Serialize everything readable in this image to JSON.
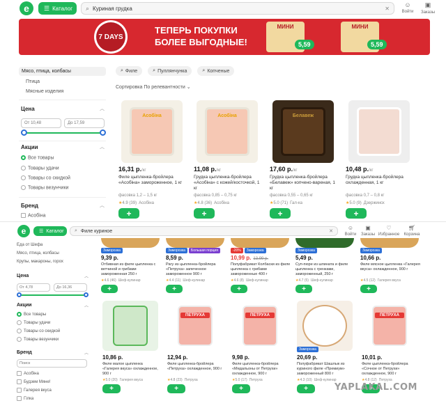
{
  "top": {
    "logo": "e",
    "catalog_label": "Каталог",
    "search_value": "Куриная грудка",
    "login_label": "Войти",
    "orders_label": "Заказы"
  },
  "banner": {
    "brand": "7 DAYS",
    "headline_1": "ТЕПЕРЬ ПОКУПКИ",
    "headline_2": "БОЛЕЕ ВЫГОДНЫЕ!",
    "product_name": "МИНИ",
    "price_1": "5,59",
    "price_2": "5,59",
    "bg": "#d7282f"
  },
  "sidebar": {
    "categories": [
      "Мясо, птица, колбасы",
      "Птица",
      "Мясные изделия"
    ],
    "price_title": "Цена",
    "price_from": "От 10,48",
    "price_to": "До 17,59",
    "promo_title": "Акции",
    "promo_options": [
      "Все товары",
      "Товары удачи",
      "Товары со скидкой",
      "Товары везунчики"
    ],
    "brand_title": "Бренд",
    "brand_first": "Асобіна"
  },
  "chips": [
    "Филе",
    "Пуллянчунка",
    "Копченые"
  ],
  "sort_label": "Сортировка По релевантности",
  "products": [
    {
      "price": "16,31 р.",
      "unit": "/кг",
      "name": "Филе цыпленка-бройлера «Асобіна» замороженное, 1 кг",
      "meta": "фасовка 1,2 – 1,5 кг",
      "rating": "4.9 (39)",
      "brand": "Асобіна",
      "pack_label": "Асобіна",
      "pack_color": "#f4f0e6",
      "accent": "#e9a100"
    },
    {
      "price": "11,08 р.",
      "unit": "/кг",
      "name": "Грудка цыпленка-бройлера «Асобіна» с кожей/косточкой, 1 кг",
      "meta": "фасовка 0,85 – 0,75 кг",
      "rating": "4.8 (36)",
      "brand": "Асобіна",
      "pack_label": "Асобіна",
      "pack_color": "#f4f0e6",
      "accent": "#e9a100"
    },
    {
      "price": "17,60 р.",
      "unit": "/кг",
      "name": "Грудка цыпленка-бройлера «Белавеж» копчено-вареная, 1 кг",
      "meta": "фасовка 0,55 – 0,65 кг",
      "rating": "5.0 (71)",
      "brand": "Гал-ка",
      "pack_label": "Белавеж",
      "pack_color": "#3a2a1a",
      "accent": "#c89a3a"
    },
    {
      "price": "10,48 р.",
      "unit": "/кг",
      "name": "Грудка цыпленка-бройлера охлажденная, 1 кг",
      "meta": "фасовка 0,7 – 0,8 кг",
      "rating": "5.0 (9)",
      "brand": "Дзержинск",
      "pack_label": "",
      "pack_color": "#eeeeee",
      "accent": "#b8263a"
    }
  ],
  "second": {
    "catalog_label": "Каталог",
    "search_value": "Филе куриное",
    "icons": [
      "Войти",
      "Заказы",
      "Избранное",
      "Корзина"
    ],
    "sidebar": {
      "categories": [
        "Еда от Шефа",
        "Мясо, птица, колбасы",
        "Крупы, макароны, горох"
      ],
      "price_title": "Цена",
      "price_from": "От 4,78",
      "price_to": "До 16,36",
      "promo_title": "Акции",
      "promo_options": [
        "Все товары",
        "Товары удачи",
        "Товары со скидкой",
        "Товары везунчики"
      ],
      "brand_title": "Бренд",
      "brand_search": "Поиск",
      "brands": [
        "Асобіна",
        "Будзем Мяне!",
        "Галерея вкуса",
        "Гілка"
      ]
    },
    "row1": [
      {
        "price": "9,39 р.",
        "badge": "Заморозка",
        "badge_color": "#2c6fd6",
        "name": "Отбивная из филе цыпленка с ветчиной и грибами замороженная 250 г",
        "rating": "4.6 (46)",
        "brand": "Шеф-кулинар"
      },
      {
        "price": "8,59 р.",
        "badge": "Заморозка",
        "badge_color": "#2c6fd6",
        "badge2": "Большая порция",
        "name": "Рагу из цыпленка-бройлера «Петруха» запеченное замороженное 900 г",
        "rating": "4.4 (11)",
        "brand": "Шеф-кулинар"
      },
      {
        "price": "10,99 р.",
        "old": "13,99 р.",
        "badge": "-20%",
        "badge_color": "#e53935",
        "badge2": "Заморозка",
        "name": "Полуфабрикат Колбаски из филе цыпленка с грибами замороженные 400 г",
        "rating": "4.6 (8)",
        "brand": "Шеф-кулинар"
      },
      {
        "price": "5,49 р.",
        "badge": "Заморозка",
        "badge_color": "#2c6fd6",
        "name": "Суп-пюре из шпината и филе цыпленка с гренками, замороженный, 250 г",
        "rating": "4.7 (5)",
        "brand": "Шеф-кулинар"
      },
      {
        "price": "10,66 р.",
        "badge": "Заморозка",
        "badge_color": "#2c6fd6",
        "name": "Филе мясное цыпленка «Галерея вкуса» охлажденное, 900 г",
        "rating": "4.5 (12)",
        "brand": "Галерея вкуса"
      }
    ],
    "row2": [
      {
        "price": "10,86 р.",
        "name": "Филе малое цыпленка «Галерея вкуса» охлажденное, 900 г",
        "rating": "5.0 (20)",
        "brand": "Галерея вкуса",
        "pack_label": "",
        "pack_color": "#e8f3e6"
      },
      {
        "price": "12,94 р.",
        "name": "Филе цыпленка-бройлера «Петруха» охлажденное, 900 г",
        "rating": "4.8 (23)",
        "brand": "Петруха",
        "pack_label": "ПЕТРУХА",
        "pack_color": "#ffffff"
      },
      {
        "price": "9,98 р.",
        "name": "Филе цыпленка-бройлера «Медальоны от Петрухи» охлажденное, 900 г",
        "rating": "5.0 (17)",
        "brand": "Петруха",
        "pack_label": "ПЕТРУХА",
        "pack_color": "#ffffff"
      },
      {
        "price": "20,69 р.",
        "badge": "Заморозка",
        "badge_color": "#2c6fd6",
        "name": "Полуфабрикат Шашлык из куриного филе «Премиум» замороженный 800 г",
        "rating": "4.3 (10)",
        "brand": "Шеф-кулинар",
        "pack_label": "",
        "pack_color": "#f6efe6"
      },
      {
        "price": "10,01 р.",
        "name": "Филе цыпленка-бройлера «Сочное от Петрухи» охлажденное, 900 г",
        "rating": "4.8 (12)",
        "brand": "Петруха",
        "pack_label": "ПЕТРУХА",
        "pack_color": "#ffffff"
      }
    ]
  },
  "watermark": "YAPLAKAL.COM"
}
